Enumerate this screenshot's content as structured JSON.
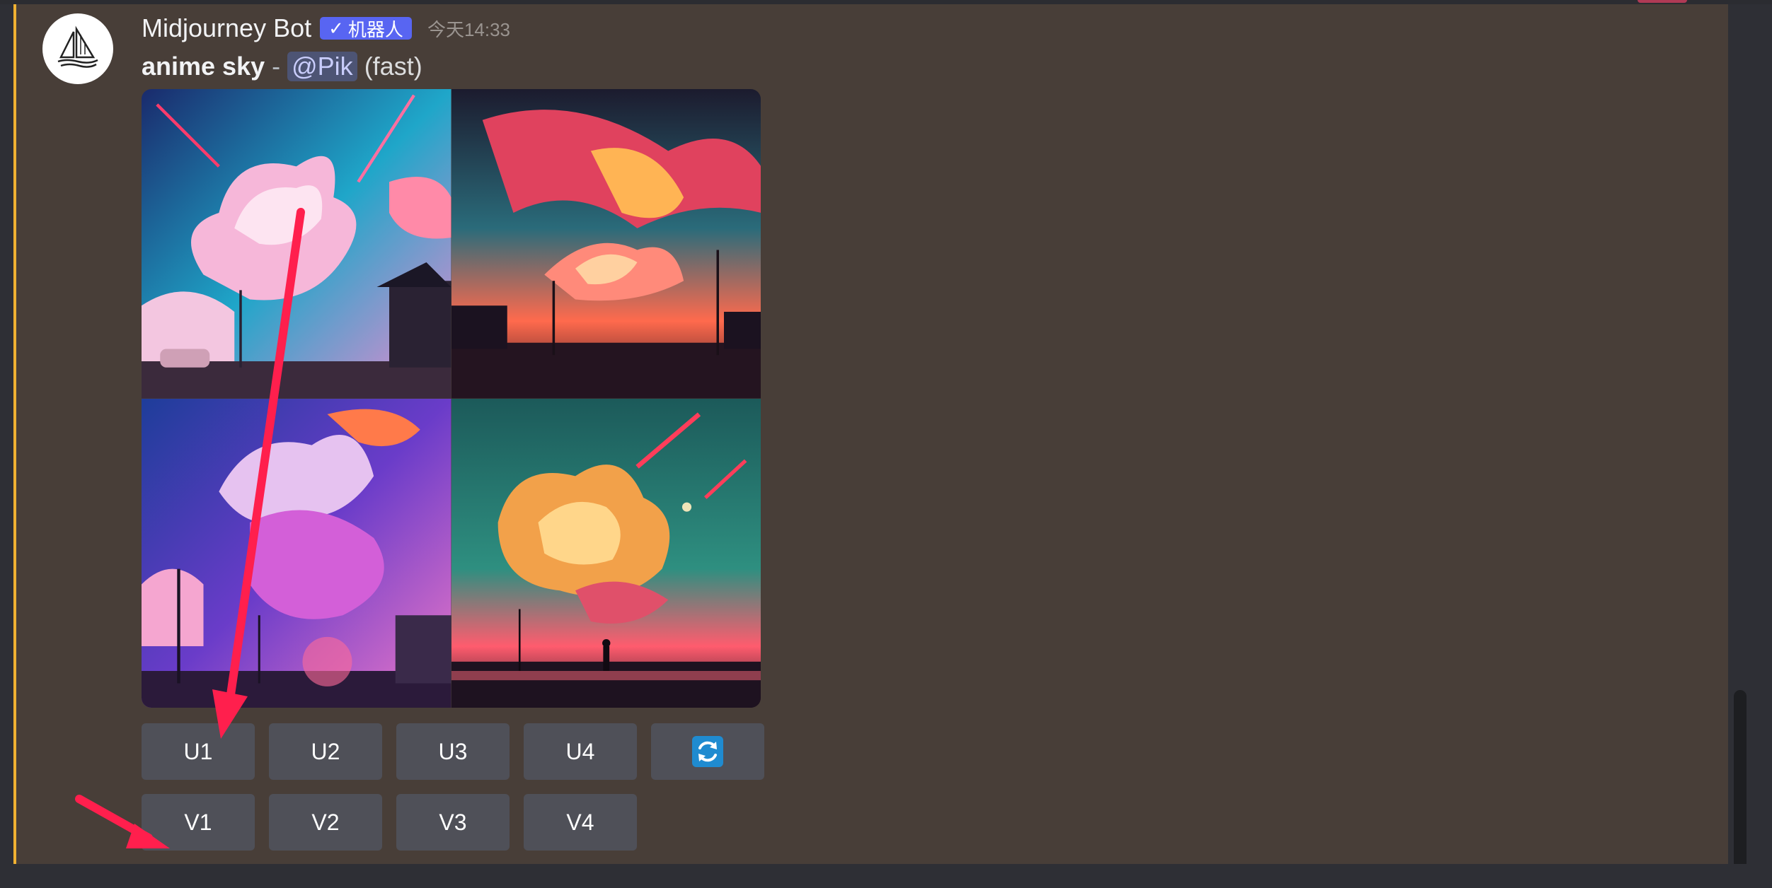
{
  "message": {
    "author": "Midjourney Bot",
    "bot_tag": "机器人",
    "timestamp": "今天14:33",
    "prompt": "anime sky",
    "separator": "-",
    "mention": "@Pik",
    "speed": "(fast)",
    "avatar_icon": "sailboat-icon"
  },
  "image_grid": {
    "tiles": [
      {
        "icon": "anime-sky-image-1"
      },
      {
        "icon": "anime-sky-image-2"
      },
      {
        "icon": "anime-sky-image-3"
      },
      {
        "icon": "anime-sky-image-4"
      }
    ]
  },
  "buttons": {
    "upscale": [
      "U1",
      "U2",
      "U3",
      "U4"
    ],
    "variation": [
      "V1",
      "V2",
      "V3",
      "V4"
    ],
    "reroll_icon": "refresh-icon"
  },
  "annotations": {
    "arrow_color": "#ff1f4d"
  },
  "colors": {
    "message_bg": "#483e38",
    "accent_border": "#f0b132",
    "button_bg": "#4f5058",
    "bot_badge": "#5865f2"
  }
}
